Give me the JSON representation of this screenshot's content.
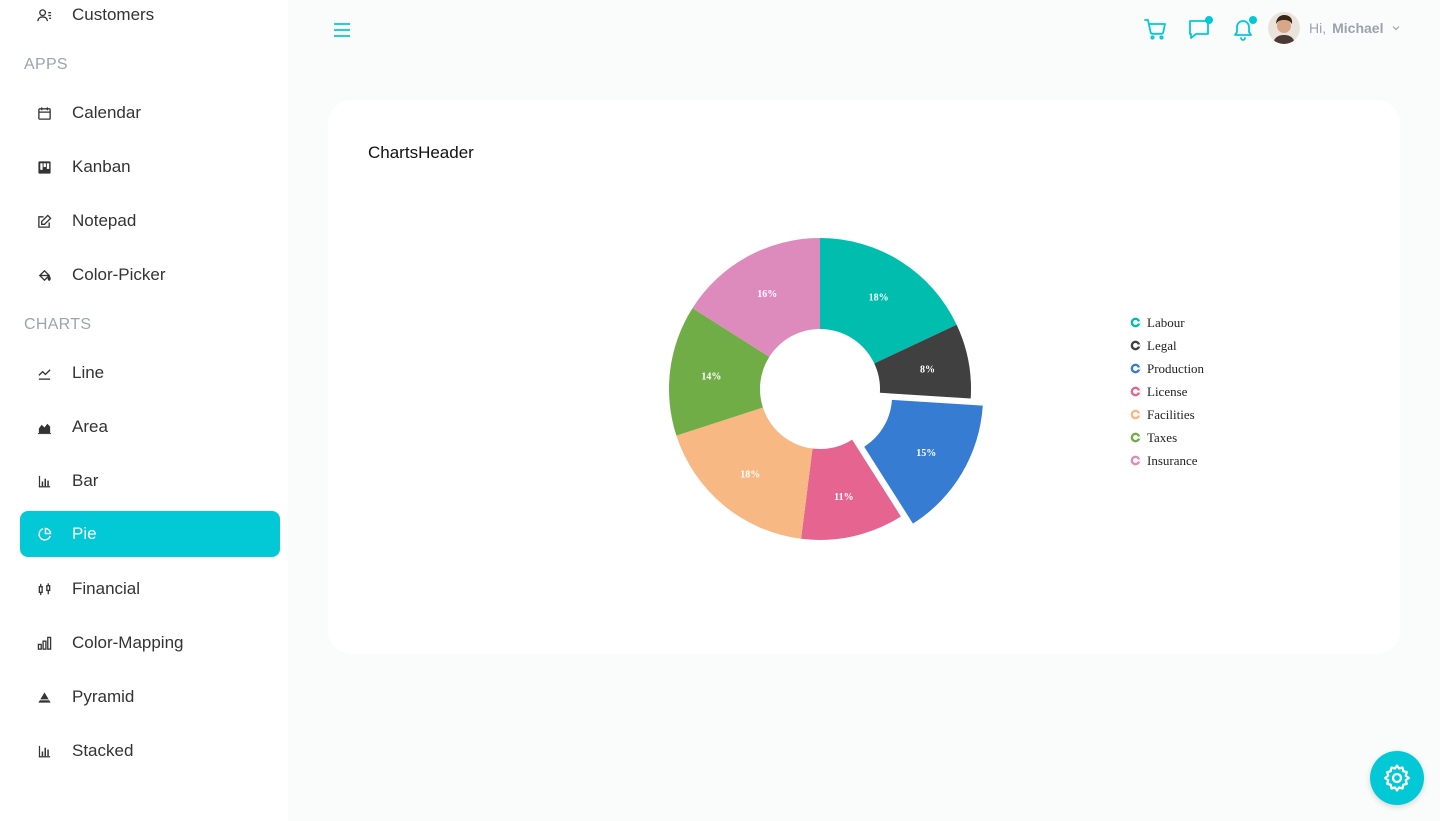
{
  "sidebar": {
    "top_item": {
      "label": "Customers",
      "icon": "customers-icon"
    },
    "sections": [
      {
        "heading": "APPS",
        "items": [
          {
            "label": "Calendar",
            "icon": "calendar-icon"
          },
          {
            "label": "Kanban",
            "icon": "kanban-icon"
          },
          {
            "label": "Notepad",
            "icon": "edit-icon"
          },
          {
            "label": "Color-Picker",
            "icon": "paint-bucket-icon"
          }
        ]
      },
      {
        "heading": "CHARTS",
        "items": [
          {
            "label": "Line",
            "icon": "line-chart-icon"
          },
          {
            "label": "Area",
            "icon": "area-chart-icon"
          },
          {
            "label": "Bar",
            "icon": "bar-chart-icon"
          },
          {
            "label": "Pie",
            "icon": "pie-chart-icon",
            "active": true
          },
          {
            "label": "Financial",
            "icon": "financial-icon"
          },
          {
            "label": "Color-Mapping",
            "icon": "color-mapping-icon"
          },
          {
            "label": "Pyramid",
            "icon": "pyramid-icon"
          },
          {
            "label": "Stacked",
            "icon": "stacked-chart-icon"
          }
        ]
      }
    ]
  },
  "navbar": {
    "menu_icon": "hamburger-icon",
    "icons": [
      "cart-icon",
      "chat-icon",
      "bell-icon"
    ],
    "greeting": "Hi,",
    "user_name": "Michael"
  },
  "card": {
    "title": "ChartsHeader"
  },
  "colors": {
    "accent": "#03c9d7"
  },
  "chart_data": {
    "type": "pie",
    "donut": true,
    "categories": [
      "Labour",
      "Legal",
      "Production",
      "License",
      "Facilities",
      "Taxes",
      "Insurance"
    ],
    "values": [
      18,
      8,
      15,
      11,
      18,
      14,
      16
    ],
    "labels": [
      "18%",
      "8%",
      "15%",
      "11%",
      "18%",
      "14%",
      "16%"
    ],
    "colors": [
      "#00bdae",
      "#404041",
      "#357cd2",
      "#e56590",
      "#f8b883",
      "#70ad47",
      "#dd8abd"
    ],
    "exploded": "Production",
    "legend": "right"
  }
}
